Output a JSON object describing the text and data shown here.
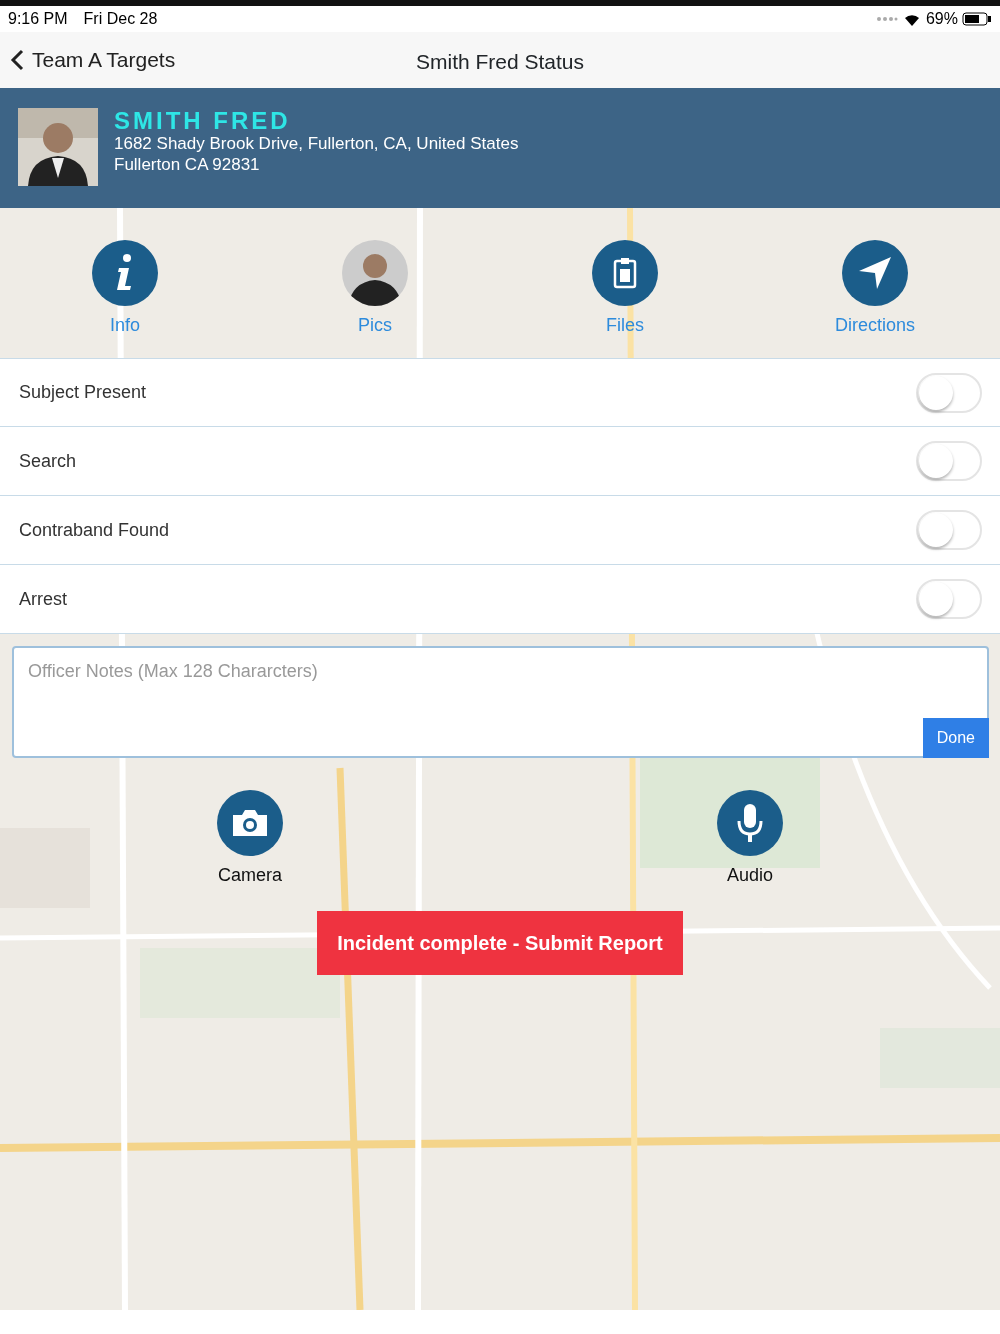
{
  "status_bar": {
    "time": "9:16 PM",
    "date": "Fri Dec 28",
    "battery": "69%"
  },
  "nav": {
    "back": "Team A Targets",
    "title": "Smith Fred Status"
  },
  "subject": {
    "name": "SMITH FRED",
    "address_lines": [
      "1682 Shady Brook Drive, Fullerton, CA, United States",
      "Fullerton CA 92831"
    ]
  },
  "actions": [
    {
      "label": "Info",
      "kind": "info"
    },
    {
      "label": "Pics"
    },
    {
      "label": "Files",
      "kind": "files"
    },
    {
      "label": "Directions",
      "kind": "directions"
    }
  ],
  "toggles": [
    {
      "label": "Subject Present",
      "on": false
    },
    {
      "label": "Search",
      "on": false
    },
    {
      "label": "Contraband Found",
      "on": false
    },
    {
      "label": "Arrest",
      "on": false
    }
  ],
  "notes": {
    "placeholder": "Officer Notes (Max 128 Chararcters)",
    "done": "Done"
  },
  "media": [
    {
      "label": "Camera",
      "kind": "camera"
    },
    {
      "label": "Audio",
      "kind": "microphone"
    }
  ],
  "submit": "Incident complete - Submit Report"
}
